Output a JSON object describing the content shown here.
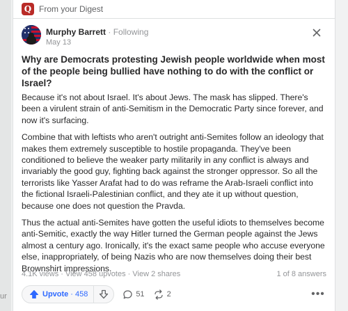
{
  "left_partial": {
    "text": "ur"
  },
  "digest": {
    "label": "From your Digest"
  },
  "author": {
    "name": "Murphy Barrett",
    "separator": " · ",
    "follow_status": "Following",
    "date": "May 13"
  },
  "question": "Why are Democrats protesting Jewish people worldwide when most of the people being bullied have nothing to do with the conflict or Israel?",
  "answer": {
    "paragraphs": [
      "Because it's not about Israel. It's about Jews. The mask has slipped. There's been a virulent strain of anti-Semitism in the Democratic Party since forever, and now it's surfacing.",
      "Combine that with leftists who aren't outright anti-Semites follow an ideology that makes them extremely susceptible to hostile propaganda. They've been conditioned to believe the weaker party militarily in any conflict is always and invariably the good guy, fighting back against the stronger oppressor. So all the terrorists like Yasser Arafat had to do was reframe the Arab-Israeli conflict into the fictional Israeli-Palestinian conflict, and they ate it up without question, because one does not question the Pravda.",
      "Thus the actual anti-Semites have gotten the useful idiots to themselves become anti-Semitic, exactly the way Hitler turned the German people against the Jews almost a century ago. Ironically, it's the exact same people who accuse everyone else, inappropriately, of being Nazis who are now themselves doing their best Brownshirt impressions."
    ]
  },
  "meta": {
    "stats": "4.1K views · View 458 upvotes · View 2 shares",
    "answer_position": "1 of 8 answers"
  },
  "actions": {
    "upvote_label": "Upvote",
    "upvote_sep": " · ",
    "upvote_count": "458",
    "comment_count": "51",
    "share_count": "2",
    "more_label": "•••"
  },
  "colors": {
    "brand": "#b92b27",
    "upvote": "#2e69ff",
    "text": "#282829",
    "muted": "#939598"
  },
  "icons": [
    "quora-logo-icon",
    "close-icon",
    "upvote-arrow-icon",
    "downvote-arrow-icon",
    "comment-icon",
    "share-icon",
    "more-icon"
  ]
}
